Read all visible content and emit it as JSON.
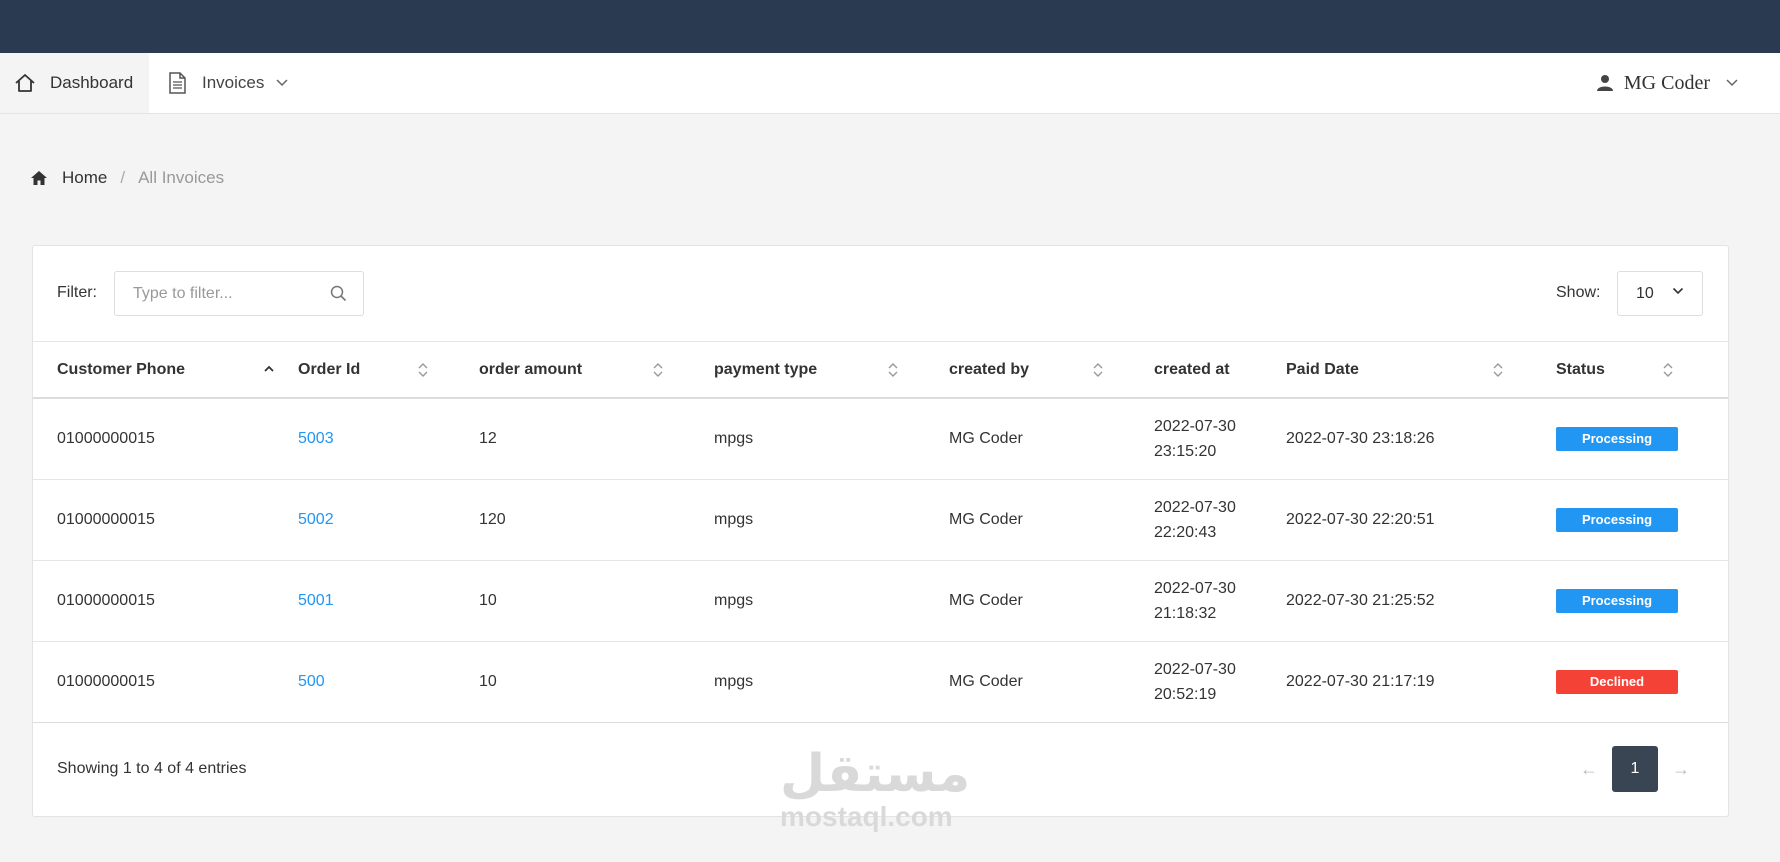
{
  "nav": {
    "dashboard_label": "Dashboard",
    "invoices_label": "Invoices",
    "user_name": "MG Coder"
  },
  "breadcrumb": {
    "home": "Home",
    "separator": "/",
    "current": "All Invoices"
  },
  "filter": {
    "label": "Filter:",
    "placeholder": "Type to filter..."
  },
  "show": {
    "label": "Show:",
    "value": "10"
  },
  "table": {
    "columns": [
      "Customer Phone",
      "Order Id",
      "order amount",
      "payment type",
      "created by",
      "created at",
      "Paid Date",
      "Status"
    ],
    "rows": [
      {
        "phone": "01000000015",
        "order_id": "5003",
        "amount": "12",
        "payment": "mpgs",
        "created_by": "MG Coder",
        "created_date": "2022-07-30",
        "created_time": "23:15:20",
        "paid": "2022-07-30 23:18:26",
        "status": "Processing"
      },
      {
        "phone": "01000000015",
        "order_id": "5002",
        "amount": "120",
        "payment": "mpgs",
        "created_by": "MG Coder",
        "created_date": "2022-07-30",
        "created_time": "22:20:43",
        "paid": "2022-07-30 22:20:51",
        "status": "Processing"
      },
      {
        "phone": "01000000015",
        "order_id": "5001",
        "amount": "10",
        "payment": "mpgs",
        "created_by": "MG Coder",
        "created_date": "2022-07-30",
        "created_time": "21:18:32",
        "paid": "2022-07-30 21:25:52",
        "status": "Processing"
      },
      {
        "phone": "01000000015",
        "order_id": "500",
        "amount": "10",
        "payment": "mpgs",
        "created_by": "MG Coder",
        "created_date": "2022-07-30",
        "created_time": "20:52:19",
        "paid": "2022-07-30 21:17:19",
        "status": "Declined"
      }
    ]
  },
  "footer": {
    "showing": "Showing 1 to 4 of 4 entries",
    "prev": "←",
    "page": "1",
    "next": "→"
  },
  "watermark": {
    "arabic": "مستقل",
    "latin": "mostaql.com"
  },
  "colors": {
    "topbar": "#2a3a51",
    "link": "#2196f3",
    "processing": "#2196f3",
    "declined": "#f44336",
    "pager_active": "#3a4553"
  }
}
